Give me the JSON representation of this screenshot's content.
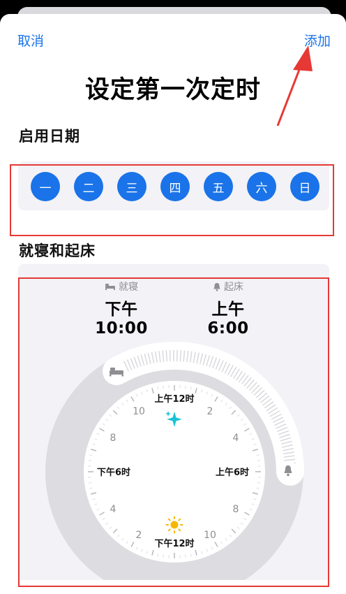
{
  "nav": {
    "cancel_label": "取消",
    "add_label": "添加"
  },
  "title": "设定第一次定时",
  "sections": {
    "days_label": "启用日期",
    "sleep_label": "就寝和起床"
  },
  "days": [
    "一",
    "二",
    "三",
    "四",
    "五",
    "六",
    "日"
  ],
  "bedtime": {
    "label": "就寝",
    "time": "下午 10:00",
    "icon": "bed-icon"
  },
  "wakeup": {
    "label": "起床",
    "time": "上午 6:00",
    "icon": "bell-icon"
  },
  "clock": {
    "top_label": "上午12时",
    "bottom_label": "下午12时",
    "left_label": "下午6时",
    "right_label": "上午6时",
    "numbers": [
      "10",
      "2",
      "8",
      "4",
      "4",
      "8",
      "2",
      "10"
    ]
  },
  "colors": {
    "accent": "#1a73e8",
    "annotation": "#e63935",
    "sparkle": "#19c3d6",
    "sun": "#f5b800"
  }
}
